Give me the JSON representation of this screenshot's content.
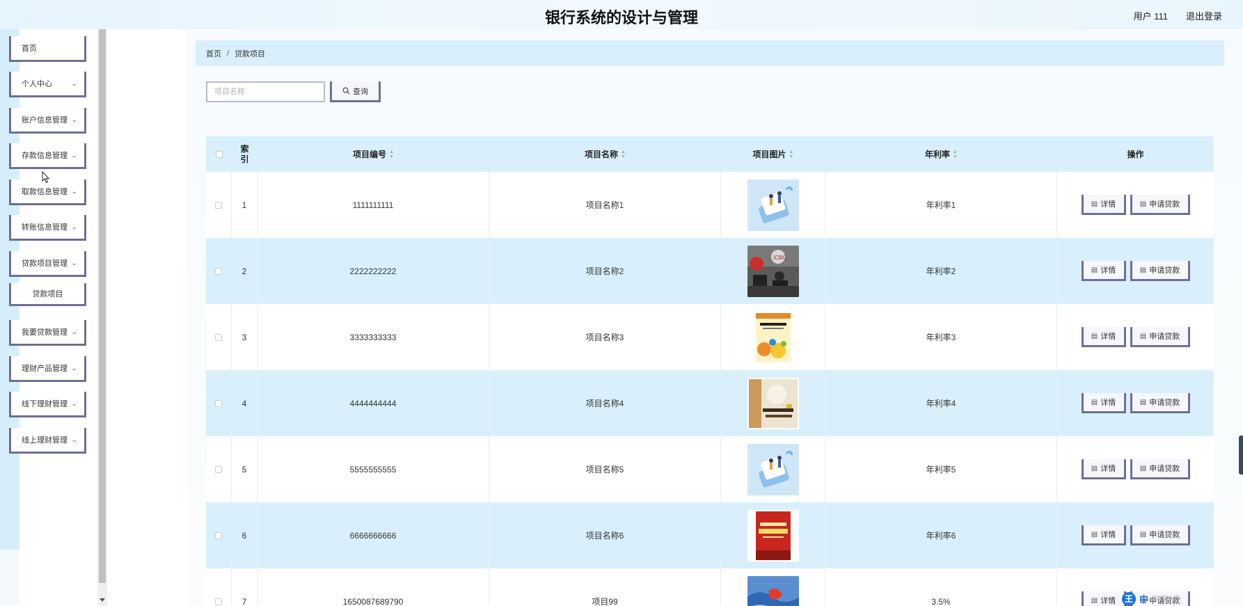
{
  "header": {
    "title": "银行系统的设计与管理",
    "user": "用户 111",
    "logout": "退出登录"
  },
  "sidebar": {
    "items": [
      {
        "label": "首页",
        "has_chevron": false
      },
      {
        "label": "个人中心",
        "has_chevron": true
      },
      {
        "label": "账户信息管理",
        "has_chevron": true
      },
      {
        "label": "存款信息管理",
        "has_chevron": true
      },
      {
        "label": "取款信息管理",
        "has_chevron": true
      },
      {
        "label": "转账信息管理",
        "has_chevron": true
      },
      {
        "label": "贷款项目管理",
        "has_chevron": true
      },
      {
        "label": "贷款项目",
        "has_chevron": false,
        "submenu": true
      },
      {
        "label": "我要贷款管理",
        "has_chevron": true
      },
      {
        "label": "理财产品管理",
        "has_chevron": true
      },
      {
        "label": "线下理财管理",
        "has_chevron": true
      },
      {
        "label": "线上理财管理",
        "has_chevron": true
      }
    ]
  },
  "breadcrumb": {
    "home": "首页",
    "separator": "/",
    "current": "贷款项目"
  },
  "search": {
    "placeholder": "项目名称",
    "button_label": "查询",
    "button_icon": "search-icon"
  },
  "table": {
    "headers": {
      "index": "索引",
      "code": "项目编号",
      "name": "项目名称",
      "image": "项目图片",
      "rate": "年利率",
      "actions": "操作"
    },
    "rows": [
      {
        "index": "1",
        "code": "1111111111",
        "name": "项目名称1",
        "rate": "年利率1",
        "image_icon": "illustration-image"
      },
      {
        "index": "2",
        "code": "2222222222",
        "name": "项目名称2",
        "rate": "年利率2",
        "image_icon": "bank-office-photo"
      },
      {
        "index": "3",
        "code": "3333333333",
        "name": "项目名称3",
        "rate": "年利率3",
        "image_icon": "book-cover-image"
      },
      {
        "index": "4",
        "code": "4444444444",
        "name": "项目名称4",
        "rate": "年利率4",
        "image_icon": "book-cover-image"
      },
      {
        "index": "5",
        "code": "5555555555",
        "name": "项目名称5",
        "rate": "年利率5",
        "image_icon": "illustration-image"
      },
      {
        "index": "6",
        "code": "6666666666",
        "name": "项目名称6",
        "rate": "年利率6",
        "image_icon": "book-cover-image"
      },
      {
        "index": "7",
        "code": "1650087689790",
        "name": "项目99",
        "rate": "3.5%",
        "image_icon": "ocean-image"
      }
    ],
    "action_detail": "详情",
    "action_apply": "申请贷款"
  },
  "tray": {
    "app_badge": "王",
    "ime": "中",
    "watermark": "CSDN @"
  },
  "colors": {
    "accent_border": "#6e6f92",
    "light_blue": "#d9f0fc",
    "sidebar_bg": "#d6eefb"
  }
}
